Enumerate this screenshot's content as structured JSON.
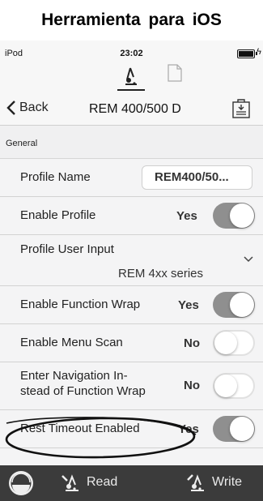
{
  "caption": "Herramienta para iOS",
  "status_bar": {
    "carrier": "iPod",
    "time": "23:02"
  },
  "nav": {
    "back_label": "Back",
    "title": "REM 400/500 D"
  },
  "section": {
    "title": "General"
  },
  "settings": [
    {
      "label": "Profile Name",
      "value": "REM400/50..."
    },
    {
      "label": "Enable Profile",
      "value": "Yes",
      "toggle": true
    },
    {
      "label": "Profile User Input",
      "value": "REM 4xx series"
    },
    {
      "label": "Enable Function Wrap",
      "value": "Yes",
      "toggle": true
    },
    {
      "label": "Enable Menu Scan",
      "value": "No",
      "toggle": false
    },
    {
      "label_line1": "Enter Navigation In-",
      "label_line2": "stead of Function Wrap",
      "value": "No",
      "toggle": false
    },
    {
      "label": "Rest Timeout Enabled",
      "value": "Yes",
      "toggle": true
    }
  ],
  "tabbar": {
    "read_label": "Read",
    "write_label": "Write"
  },
  "icons": [
    "drive-mode-icon",
    "document-icon",
    "back-chevron-icon",
    "save-to-device-icon",
    "chevron-down-icon",
    "app-logo-icon",
    "read-icon",
    "write-icon",
    "battery-icon"
  ],
  "colors": {
    "toggle_on": "#8f8f8f",
    "tabbar": "#3b3b3b",
    "background": "#f4f4f5"
  }
}
